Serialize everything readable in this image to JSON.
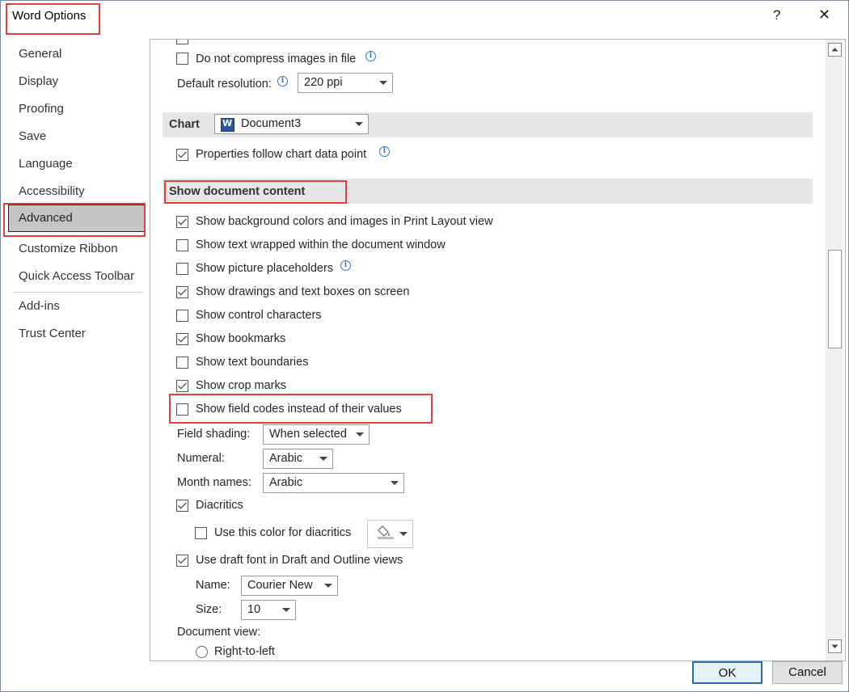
{
  "window": {
    "title": "Word Options",
    "help": "?",
    "close": "✕"
  },
  "sidebar": {
    "items": [
      {
        "label": "General"
      },
      {
        "label": "Display"
      },
      {
        "label": "Proofing"
      },
      {
        "label": "Save"
      },
      {
        "label": "Language"
      },
      {
        "label": "Accessibility"
      },
      {
        "label": "Advanced"
      },
      {
        "label": "Customize Ribbon"
      },
      {
        "label": "Quick Access Toolbar"
      },
      {
        "label": "Add-ins"
      },
      {
        "label": "Trust Center"
      }
    ],
    "selected": "Advanced"
  },
  "image_size": {
    "do_not_compress": {
      "label": "Do not compress images in file",
      "checked": false
    },
    "default_resolution": {
      "label": "Default resolution:",
      "value": "220 ppi"
    }
  },
  "chart": {
    "section_title": "Chart",
    "document": "Document3",
    "properties_follow": {
      "label": "Properties follow chart data point",
      "checked": true
    }
  },
  "show_document_content": {
    "section_title": "Show document content",
    "options": [
      {
        "label": "Show background colors and images in Print Layout view",
        "checked": true
      },
      {
        "label": "Show text wrapped within the document window",
        "checked": false
      },
      {
        "label": "Show picture placeholders",
        "checked": false
      },
      {
        "label": "Show drawings and text boxes on screen",
        "checked": true
      },
      {
        "label": "Show control characters",
        "checked": false
      },
      {
        "label": "Show bookmarks",
        "checked": true
      },
      {
        "label": "Show text boundaries",
        "checked": false
      },
      {
        "label": "Show crop marks",
        "checked": true
      },
      {
        "label": "Show field codes instead of their values",
        "checked": false
      }
    ],
    "field_shading": {
      "label": "Field shading:",
      "value": "When selected"
    },
    "numeral": {
      "label": "Numeral:",
      "value": "Arabic"
    },
    "month_names": {
      "label": "Month names:",
      "value": "Arabic"
    },
    "diacritics": {
      "label": "Diacritics",
      "checked": true
    },
    "diacritics_color": {
      "label": "Use this color for diacritics",
      "checked": false
    },
    "draft_font": {
      "label": "Use draft font in Draft and Outline views",
      "checked": true
    },
    "font_name": {
      "label": "Name:",
      "value": "Courier New"
    },
    "font_size": {
      "label": "Size:",
      "value": "10"
    },
    "document_view": {
      "label": "Document view:",
      "option": "Right-to-left"
    }
  },
  "buttons": {
    "ok": "OK",
    "cancel": "Cancel"
  },
  "colors": {
    "highlight": "#e0413f",
    "selected_bg": "#c5c5c5",
    "section_bg": "#e6e6e6",
    "info": "#2b78c5"
  }
}
